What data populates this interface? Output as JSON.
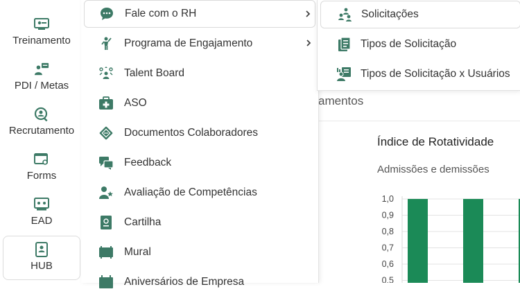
{
  "colors": {
    "accent": "#3d7a66",
    "bar": "#1b8a57"
  },
  "rail": {
    "items": [
      {
        "label": "Treinamento",
        "icon": "training-icon"
      },
      {
        "label": "PDI / Metas",
        "icon": "goals-icon"
      },
      {
        "label": "Recrutamento",
        "icon": "recruitment-icon"
      },
      {
        "label": "Forms",
        "icon": "forms-icon"
      },
      {
        "label": "EAD",
        "icon": "ead-icon"
      },
      {
        "label": "HUB",
        "icon": "hub-icon"
      }
    ]
  },
  "menu": {
    "items": [
      {
        "label": "Fale com o RH",
        "icon": "chat-icon",
        "has_submenu": true
      },
      {
        "label": "Programa de Engajamento",
        "icon": "engagement-icon",
        "has_submenu": true
      },
      {
        "label": "Talent Board",
        "icon": "talent-board-icon"
      },
      {
        "label": "ASO",
        "icon": "medical-kit-icon"
      },
      {
        "label": "Documentos Colaboradores",
        "icon": "documents-icon"
      },
      {
        "label": "Feedback",
        "icon": "feedback-icon"
      },
      {
        "label": "Avaliação de Competências",
        "icon": "user-star-icon"
      },
      {
        "label": "Cartilha",
        "icon": "booklet-icon"
      },
      {
        "label": "Mural",
        "icon": "board-icon"
      },
      {
        "label": "Aniversários de Empresa",
        "icon": "calendar-icon"
      }
    ]
  },
  "submenu": {
    "items": [
      {
        "label": "Solicitações",
        "icon": "requests-icon"
      },
      {
        "label": "Tipos de Solicitação",
        "icon": "request-types-icon"
      },
      {
        "label": "Tipos de Solicitação x Usuários",
        "icon": "request-users-icon"
      }
    ]
  },
  "background": {
    "heading_fragment": "amentos",
    "chart_title": "Índice de Rotatividade",
    "chart_subtitle": "Admissões e demissões"
  },
  "chart_data": {
    "type": "bar",
    "title": "Índice de Rotatividade",
    "subtitle": "Admissões e demissões",
    "ytick_labels": [
      "1,0",
      "0,9",
      "0,8",
      "0,7",
      "0,6",
      "0,5"
    ],
    "yticks": [
      1.0,
      0.9,
      0.8,
      0.7,
      0.6,
      0.5
    ],
    "values": [
      1.0,
      1.0,
      1.0
    ],
    "ylim_visible": [
      0.5,
      1.0
    ],
    "grid": true
  }
}
